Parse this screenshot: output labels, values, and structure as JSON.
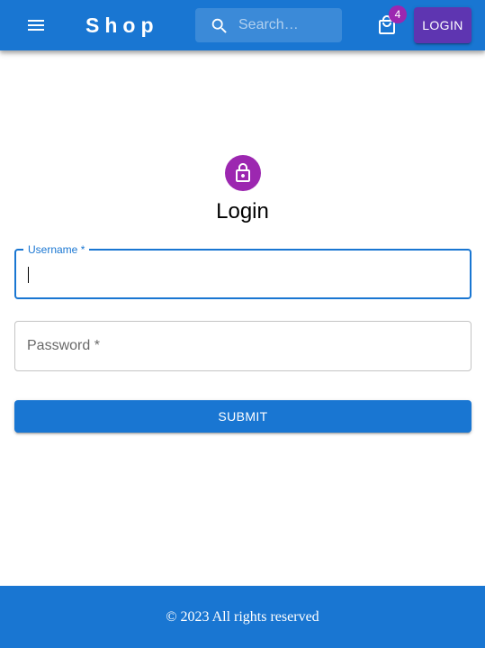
{
  "theme": {
    "primary": "#1976d2",
    "secondary": "#9c27b0",
    "login_button": "#5e35b1"
  },
  "appbar": {
    "menu_icon": "menu-icon",
    "brand": "Shop",
    "search": {
      "icon": "search-icon",
      "placeholder": "Search…",
      "value": ""
    },
    "cart": {
      "icon": "shopping-bag-icon",
      "badge_count": "4"
    },
    "login_label": "LOGIN"
  },
  "login_form": {
    "icon": "lock-icon",
    "title": "Login",
    "username": {
      "label": "Username *",
      "value": "",
      "focused": true
    },
    "password": {
      "label": "Password *",
      "value": ""
    },
    "submit_label": "SUBMIT"
  },
  "footer": {
    "text": "© 2023 All rights reserved"
  }
}
